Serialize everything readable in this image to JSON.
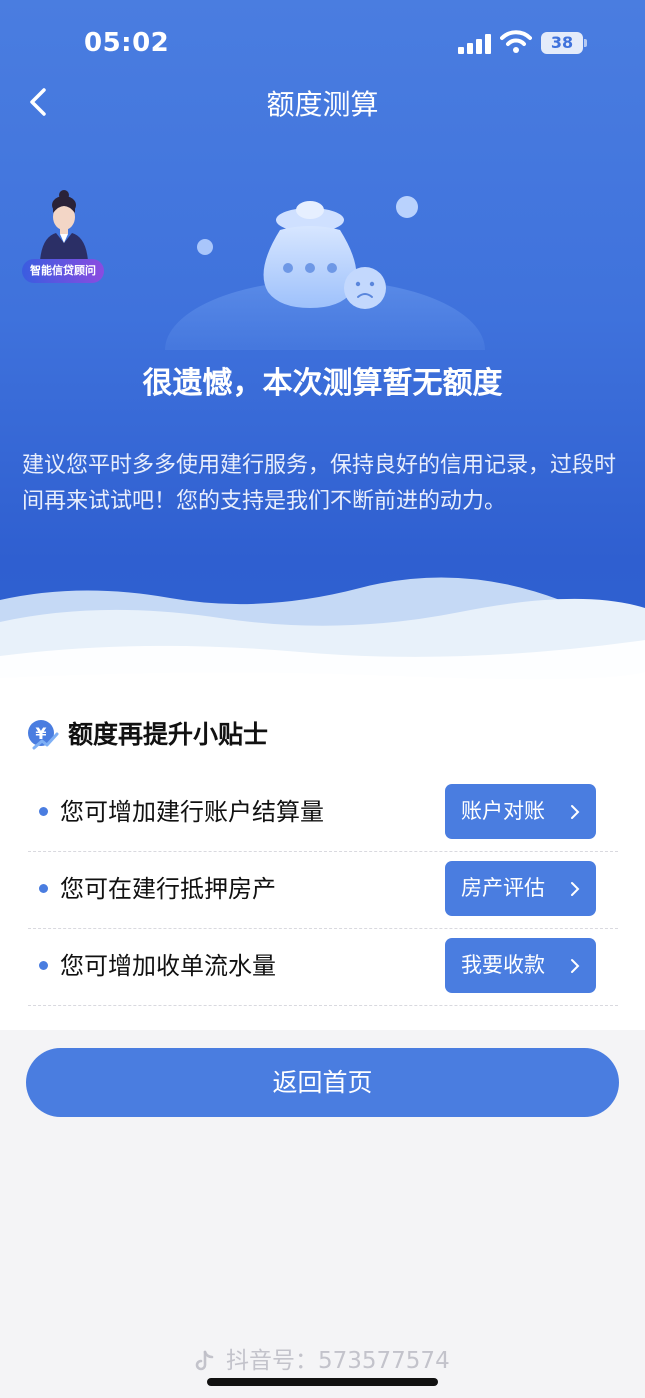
{
  "status_bar": {
    "time": "05:02",
    "battery": "38"
  },
  "nav": {
    "title": "额度测算"
  },
  "advisor": {
    "label": "智能信贷顾问"
  },
  "result": {
    "title": "很遗憾，本次测算暂无额度",
    "description": "建议您平时多多使用建行服务，保持良好的信用记录，过段时间再来试试吧！您的支持是我们不断前进的动力。"
  },
  "tips": {
    "title": "额度再提升小贴士",
    "items": [
      {
        "text": "您可增加建行账户结算量",
        "button": "账户对账"
      },
      {
        "text": "您可在建行抵押房产",
        "button": "房产评估"
      },
      {
        "text": "您可增加收单流水量",
        "button": "我要收款"
      }
    ]
  },
  "home_button": "返回首页",
  "watermark": "抖音号：573577574",
  "colors": {
    "primary": "#4a7de0",
    "hero_dark": "#2f5fd0",
    "page_bg": "#f4f4f6"
  }
}
